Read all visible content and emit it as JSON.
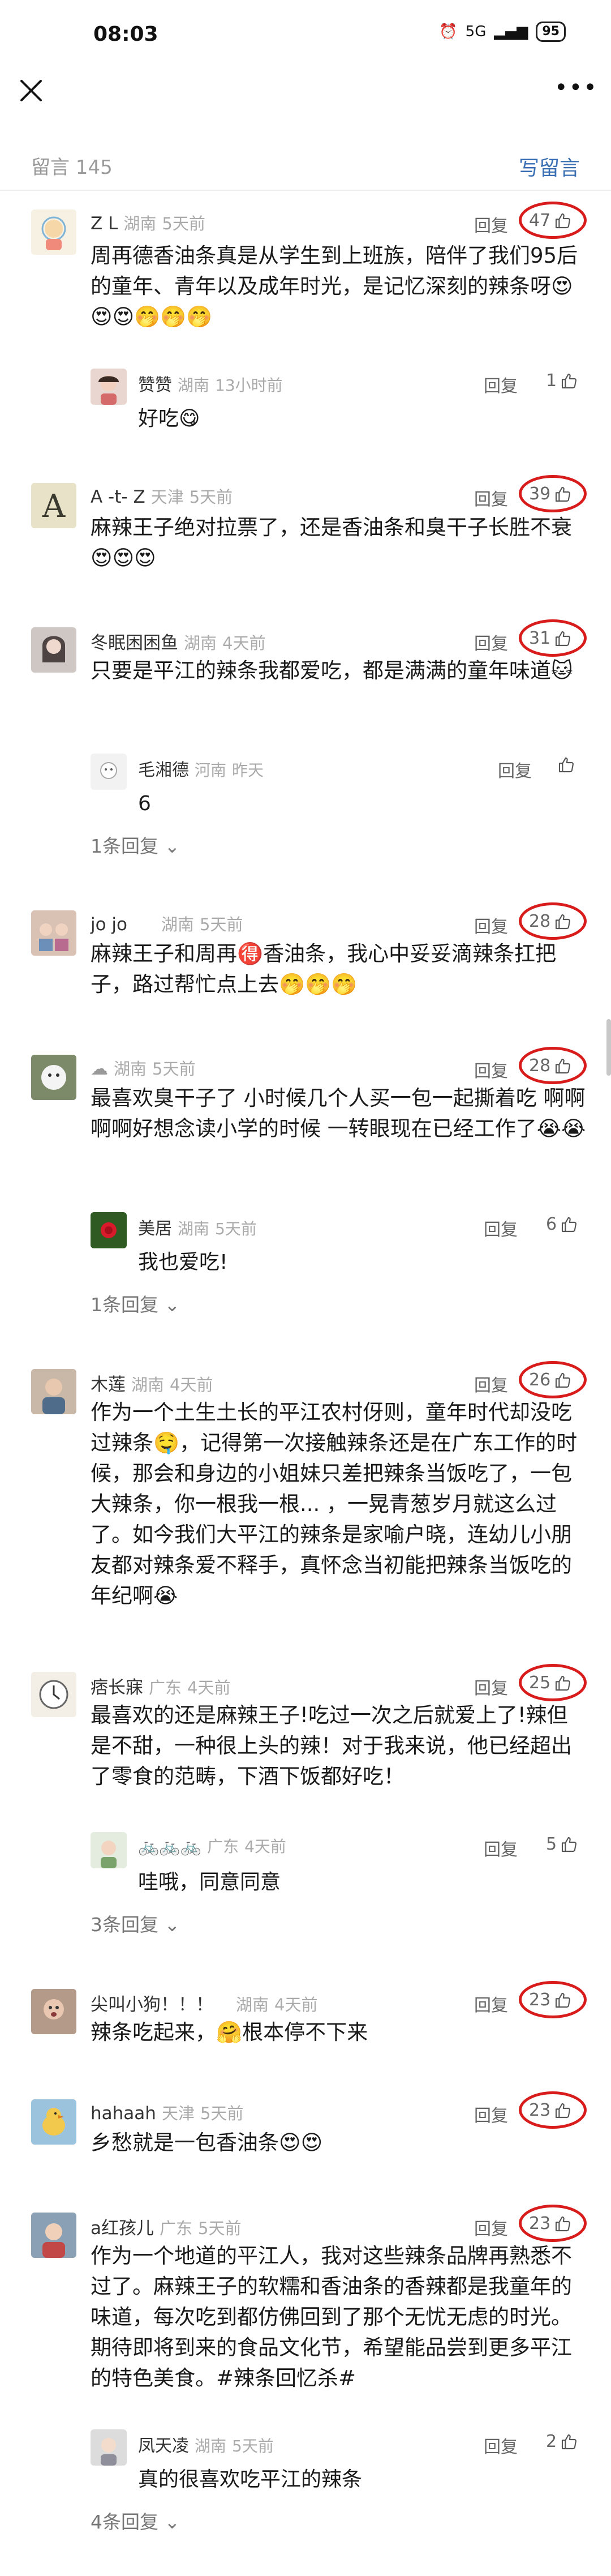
{
  "status": {
    "time": "08:03",
    "battery": "95",
    "network": "5G"
  },
  "header": {
    "count_label": "留言 145",
    "write_label": "写留言"
  },
  "c1": {
    "name": "Z L",
    "loc": "湖南",
    "ago": "5天前",
    "reply": "回复",
    "likes": "47",
    "text": "周再德香油条真是从学生到上班族，陪伴了我们95后的童年、青年以及成年时光，是记忆深刻的辣条呀😍😍😍🤭🤭🤭"
  },
  "c1r": {
    "name": "赞赞",
    "loc": "湖南",
    "ago": "13小时前",
    "reply": "回复",
    "likes": "1",
    "text": "好吃😋"
  },
  "c2": {
    "name": "A -t- Z",
    "loc": "天津",
    "ago": "5天前",
    "reply": "回复",
    "likes": "39",
    "text": "麻辣王子绝对拉票了，还是香油条和臭干子长胜不衰😍😍😍"
  },
  "c3": {
    "name": "冬眠困困鱼",
    "loc": "湖南",
    "ago": "4天前",
    "reply": "回复",
    "likes": "31",
    "text": "只要是平江的辣条我都爱吃，都是满满的童年味道🐱"
  },
  "c3r": {
    "name": "毛湘德",
    "loc": "河南",
    "ago": "昨天",
    "reply": "回复",
    "text": "6",
    "more": "1条回复 ⌄"
  },
  "c4": {
    "name": "jo jo",
    "loc": "湖南",
    "ago": "5天前",
    "reply": "回复",
    "likes": "28",
    "text": "麻辣王子和周再🉐香油条，我心中妥妥滴辣条扛把子，路过帮忙点上去🤭🤭🤭"
  },
  "c5": {
    "name": "",
    "loc": "湖南",
    "ago": "5天前",
    "reply": "回复",
    "likes": "28",
    "text": "最喜欢臭干子了 小时候几个人买一包一起撕着吃 啊啊啊啊好想念读小学的时候 一转眼现在已经工作了😭😭"
  },
  "c5r": {
    "name": "美居",
    "loc": "湖南",
    "ago": "5天前",
    "reply": "回复",
    "likes": "6",
    "text": "我也爱吃!",
    "more": "1条回复 ⌄"
  },
  "c6": {
    "name": "木莲",
    "loc": "湖南",
    "ago": "4天前",
    "reply": "回复",
    "likes": "26",
    "text": "作为一个土生土长的平江农村伢则，童年时代却没吃过辣条🤤，记得第一次接触辣条还是在广东工作的时候，那会和身边的小姐妹只差把辣条当饭吃了，一包大辣条，你一根我一根... ，一晃青葱岁月就这么过了。如今我们大平江的辣条是家喻户晓，连幼儿小朋友都对辣条爱不释手，真怀念当初能把辣条当饭吃的年纪啊😭"
  },
  "c7": {
    "name": "痞长寐",
    "loc": "广东",
    "ago": "4天前",
    "reply": "回复",
    "likes": "25",
    "text": "最喜欢的还是麻辣王子!吃过一次之后就爱上了!辣但是不甜，一种很上头的辣！对于我来说，他已经超出了零食的范畴，下酒下饭都好吃！"
  },
  "c7r": {
    "name": "🚲🚲🚲",
    "loc": "广东",
    "ago": "4天前",
    "reply": "回复",
    "likes": "5",
    "text": "哇哦，同意同意",
    "more": "3条回复 ⌄"
  },
  "c8": {
    "name": "尖叫小狗！！！",
    "loc": "湖南",
    "ago": "4天前",
    "reply": "回复",
    "likes": "23",
    "text": "辣条吃起来，🤗根本停不下来"
  },
  "c9": {
    "name": "hahaah",
    "loc": "天津",
    "ago": "5天前",
    "reply": "回复",
    "likes": "23",
    "text": "乡愁就是一包香油条😍😍"
  },
  "c10": {
    "name": "a红孩儿",
    "loc": "广东",
    "ago": "5天前",
    "reply": "回复",
    "likes": "23",
    "text": "作为一个地道的平江人，我对这些辣条品牌再熟悉不过了。麻辣王子的软糯和香油条的香辣都是我童年的味道，每次吃到都仿佛回到了那个无忧无虑的时光。期待即将到来的食品文化节，希望能品尝到更多平江的特色美食。#辣条回忆杀#"
  },
  "c10r": {
    "name": "凤天凌",
    "loc": "湖南",
    "ago": "5天前",
    "reply": "回复",
    "likes": "2",
    "text": "真的很喜欢吃平江的辣条",
    "more": "4条回复 ⌄"
  }
}
